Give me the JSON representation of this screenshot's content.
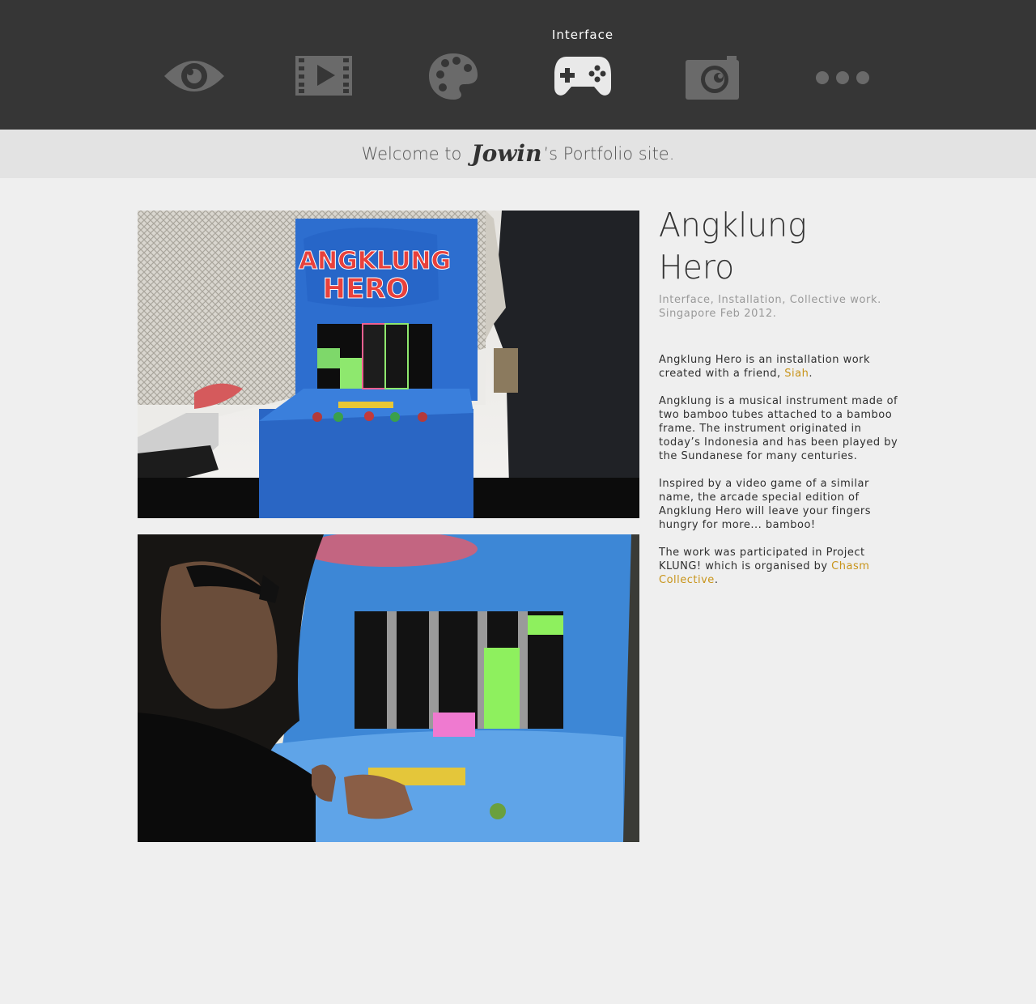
{
  "nav": {
    "items": [
      {
        "icon": "eye-icon",
        "label": ""
      },
      {
        "icon": "film-icon",
        "label": ""
      },
      {
        "icon": "palette-icon",
        "label": ""
      },
      {
        "icon": "gamepad-icon",
        "label": "Interface",
        "active": true
      },
      {
        "icon": "camera-icon",
        "label": ""
      },
      {
        "icon": "more-icon",
        "label": ""
      }
    ],
    "colors": {
      "inactive": "#6a6a6a",
      "active": "#e9e9e9",
      "bar": "#363636"
    }
  },
  "welcome": {
    "prefix": "Welcome to",
    "signature": "Jowin",
    "suffix": "’s Portfolio site."
  },
  "project": {
    "title": "Angklung Hero",
    "subtitle_line1": "Interface, Installation, Collective work.",
    "subtitle_line2": "Singapore Feb 2012.",
    "p1_text": "Angklung Hero is an installation work created with a friend, ",
    "p1_link": "Siah",
    "p1_end": ".",
    "p2": "Angklung is a musical instrument made of two bamboo tubes attached to a bamboo frame. The instrument originated in today’s Indonesia and has been played by the Sundanese for many centuries.",
    "p3": "Inspired by a video game of a similar name, the arcade special edition of Angklung Hero will leave your fingers hungry for more... bamboo!",
    "p4_text": "The work was participated in Project KLUNG! which is organised by ",
    "p4_link": "Chasm Collective",
    "p4_end": ".",
    "link_color": "#c8941a"
  },
  "photos": {
    "photo1_sign_line1": "ANGKLUNG",
    "photo1_sign_line2": "HERO"
  }
}
